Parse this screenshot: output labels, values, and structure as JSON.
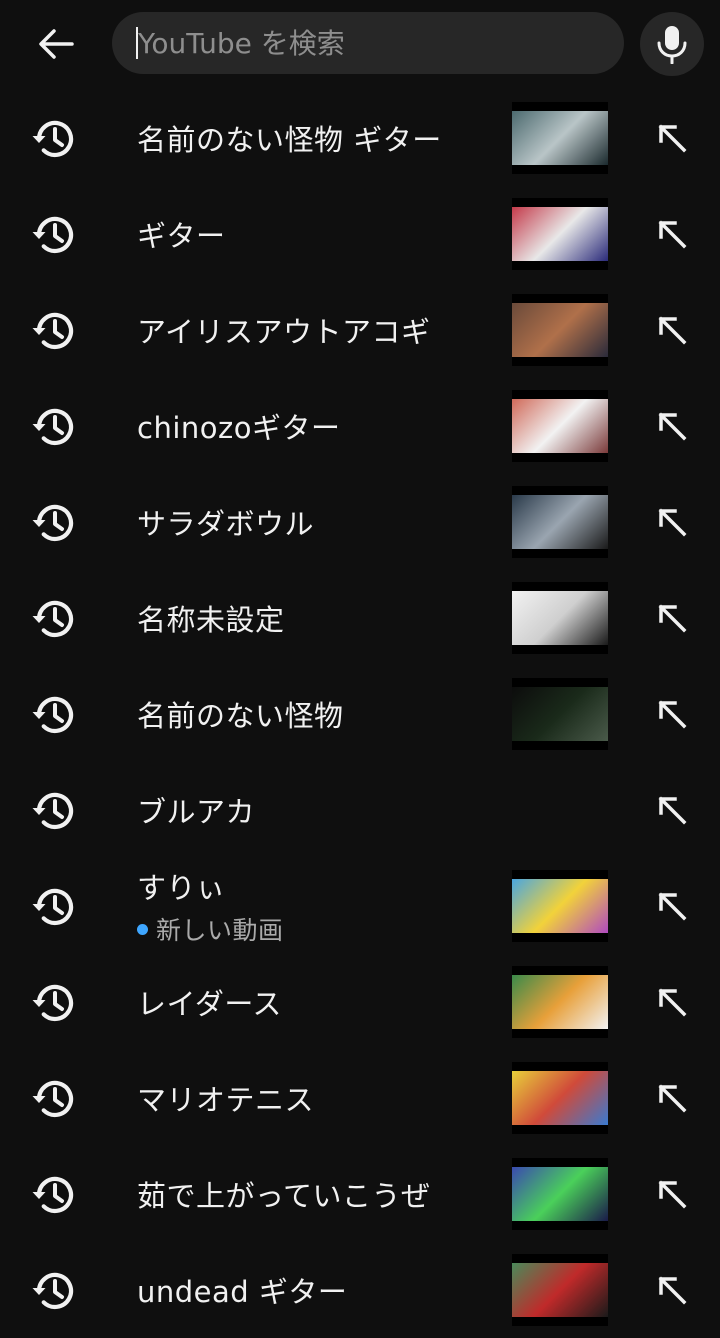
{
  "search": {
    "placeholder": "YouTube を検索"
  },
  "history": [
    {
      "query": "名前のない怪物 ギター",
      "thumb": [
        "#4c6a6f",
        "#b9c5c7",
        "#1b2a2e"
      ]
    },
    {
      "query": "ギター",
      "thumb": [
        "#c43a4a",
        "#e8e8e8",
        "#2a2a7a"
      ]
    },
    {
      "query": "アイリスアウトアコギ",
      "thumb": [
        "#6a4a3a",
        "#b0704a",
        "#2a2a3a"
      ]
    },
    {
      "query": "chinozoギター",
      "thumb": [
        "#d06a5a",
        "#f2f2f2",
        "#7a3a3a"
      ]
    },
    {
      "query": "サラダボウル",
      "thumb": [
        "#2a3a4a",
        "#9aa5b0",
        "#1a1a1a"
      ]
    },
    {
      "query": "名称未設定",
      "thumb": [
        "#f2f2f2",
        "#cfcfcf",
        "#1a1a1a"
      ]
    },
    {
      "query": "名前のない怪物",
      "thumb": [
        "#0c0c0c",
        "#1a2a1a",
        "#4a5a4a"
      ]
    },
    {
      "query": "ブルアカ",
      "thumb": null
    },
    {
      "query": "すりぃ",
      "subtitle": "新しい動画",
      "thumb": [
        "#4aa6e0",
        "#f2d23a",
        "#b04ac0"
      ]
    },
    {
      "query": "レイダース",
      "thumb": [
        "#3a8a4a",
        "#e8a03a",
        "#f2f2f2"
      ]
    },
    {
      "query": "マリオテニス",
      "thumb": [
        "#e8d03a",
        "#d04a3a",
        "#3a7ad0"
      ]
    },
    {
      "query": "茹で上がっていこうぜ",
      "thumb": [
        "#3a4ab0",
        "#4ad05a",
        "#1a1a4a"
      ]
    },
    {
      "query": "undead ギター",
      "thumb": [
        "#4a8a5a",
        "#c02a2a",
        "#1a1a1a"
      ]
    }
  ],
  "icons": {
    "back": "arrow-left-icon",
    "mic": "microphone-icon",
    "history": "history-clock-icon",
    "fill": "arrow-up-left-icon"
  }
}
